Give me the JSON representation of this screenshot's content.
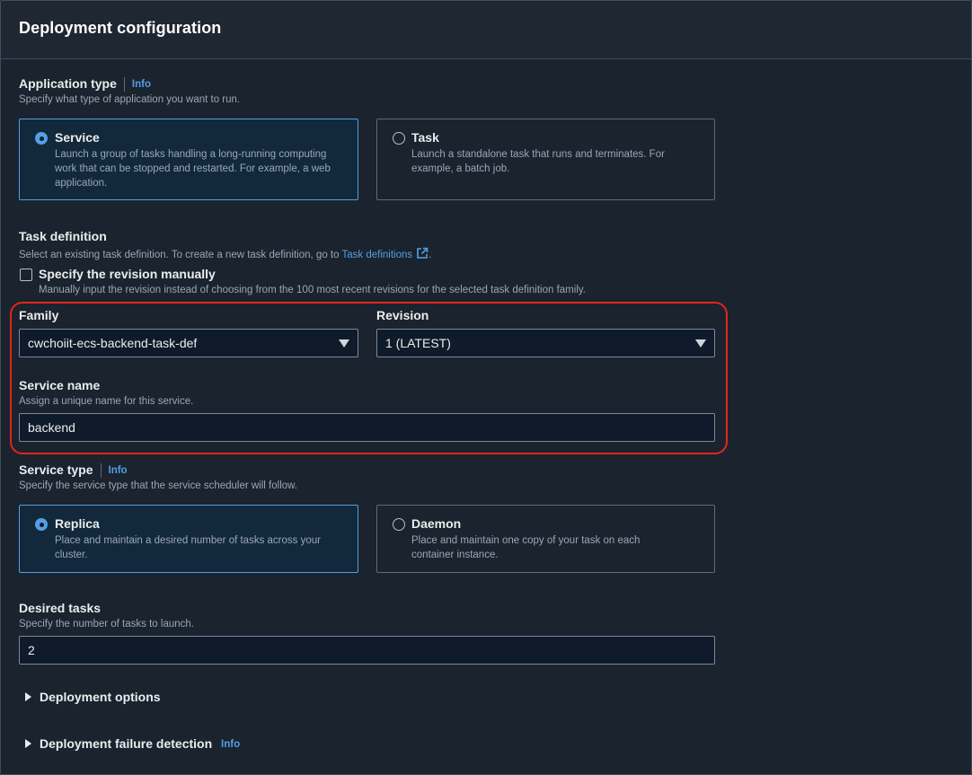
{
  "header": {
    "title": "Deployment configuration"
  },
  "application_type": {
    "label": "Application type",
    "info": "Info",
    "description": "Specify what type of application you want to run.",
    "options": [
      {
        "title": "Service",
        "description": "Launch a group of tasks handling a long-running computing work that can be stopped and restarted. For example, a web application.",
        "selected": true
      },
      {
        "title": "Task",
        "description": "Launch a standalone task that runs and terminates. For example, a batch job.",
        "selected": false
      }
    ]
  },
  "task_definition": {
    "label": "Task definition",
    "description": "Select an existing task definition. To create a new task definition, go to",
    "link": "Task definitions",
    "after_link": ".",
    "manual_checkbox": {
      "label": "Specify the revision manually",
      "description": "Manually input the revision instead of choosing from the 100 most recent revisions for the selected task definition family.",
      "checked": false
    },
    "family": {
      "label": "Family",
      "value": "cwchoiit-ecs-backend-task-def"
    },
    "revision": {
      "label": "Revision",
      "value": "1 (LATEST)"
    }
  },
  "service_name": {
    "label": "Service name",
    "description": "Assign a unique name for this service.",
    "value": "backend"
  },
  "service_type": {
    "label": "Service type",
    "info": "Info",
    "description": "Specify the service type that the service scheduler will follow.",
    "options": [
      {
        "title": "Replica",
        "description": "Place and maintain a desired number of tasks across your cluster.",
        "selected": true
      },
      {
        "title": "Daemon",
        "description": "Place and maintain one copy of your task on each container instance.",
        "selected": false
      }
    ]
  },
  "desired_tasks": {
    "label": "Desired tasks",
    "description": "Specify the number of tasks to launch.",
    "value": "2"
  },
  "expanders": [
    {
      "label": "Deployment options"
    },
    {
      "label": "Deployment failure detection",
      "info": "Info"
    }
  ],
  "colors": {
    "accent": "#539fe5",
    "highlight": "#e3261b",
    "background": "#1a232e"
  }
}
